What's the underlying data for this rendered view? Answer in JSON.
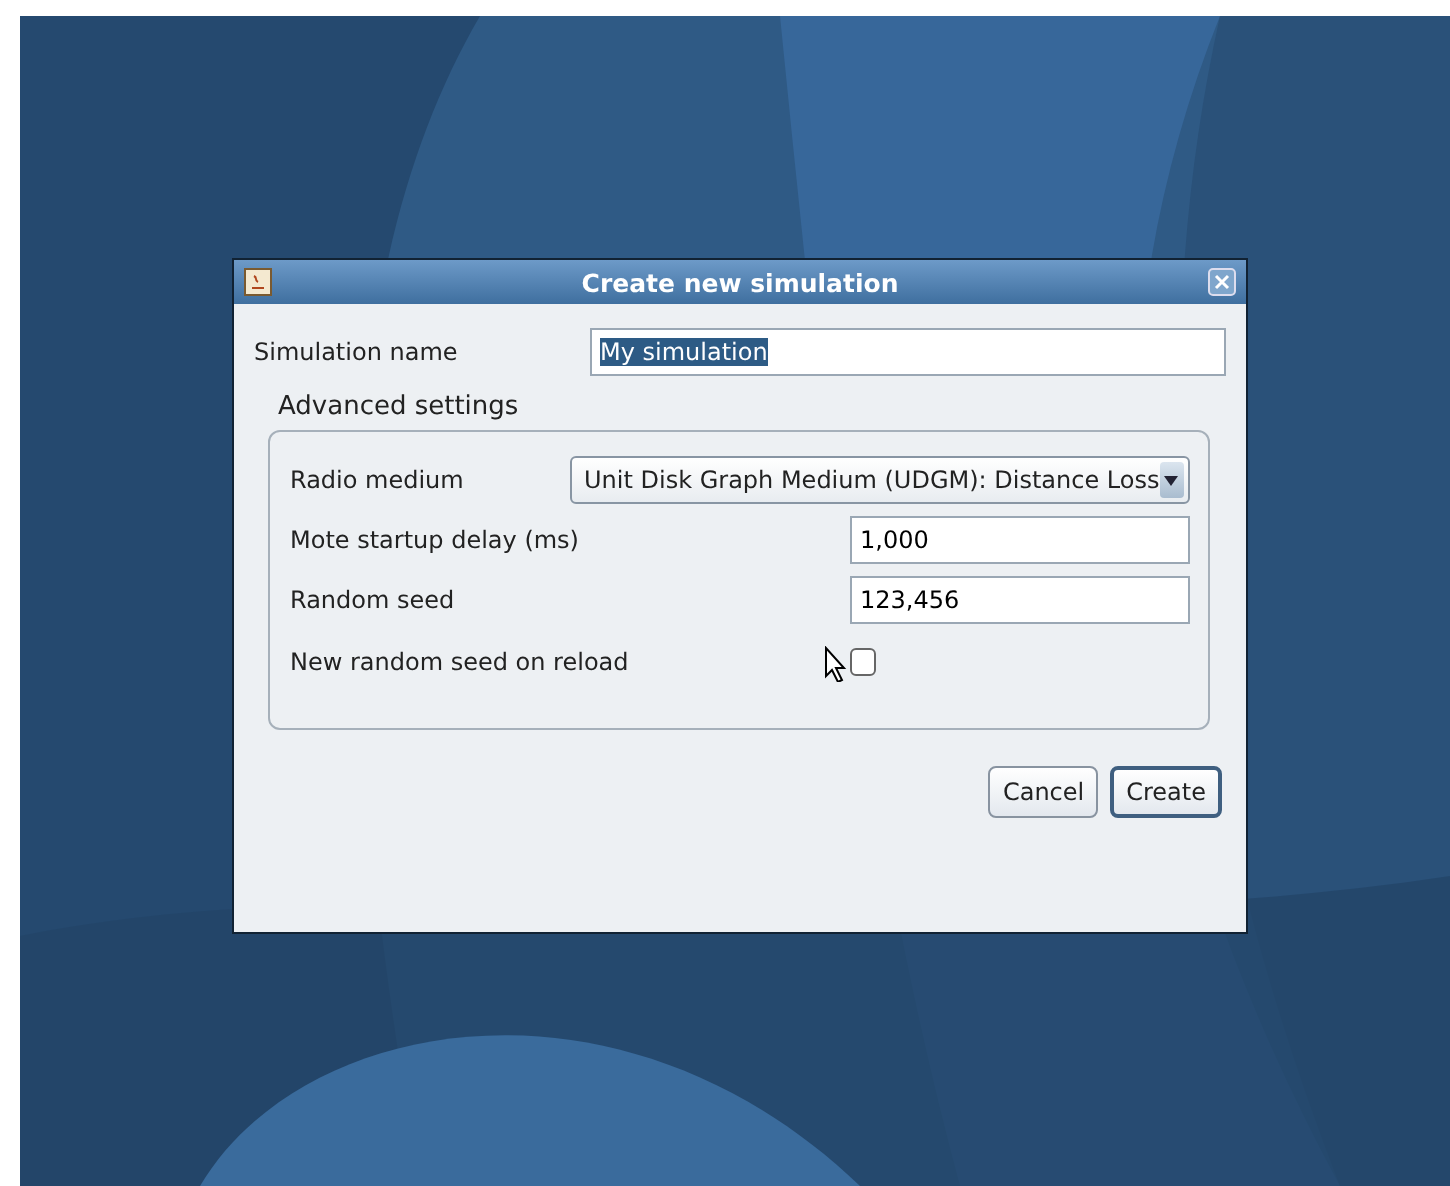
{
  "window": {
    "title": "Create new simulation"
  },
  "simulation_name": {
    "label": "Simulation name",
    "value": "My simulation",
    "text_selected": true
  },
  "advanced_settings": {
    "title": "Advanced settings",
    "rows": [
      {
        "kind": "dropdown",
        "label": "Radio medium",
        "value": "Unit Disk Graph Medium (UDGM): Distance Loss"
      },
      {
        "kind": "text",
        "label": "Mote startup delay (ms)",
        "value": "1,000"
      },
      {
        "kind": "text",
        "label": "Random seed",
        "value": "123,456"
      },
      {
        "kind": "checkbox",
        "label": "New random seed on reload",
        "checked": false
      }
    ]
  },
  "buttons": [
    {
      "label": "Cancel",
      "focused": false
    },
    {
      "label": "Create",
      "focused": true
    }
  ]
}
